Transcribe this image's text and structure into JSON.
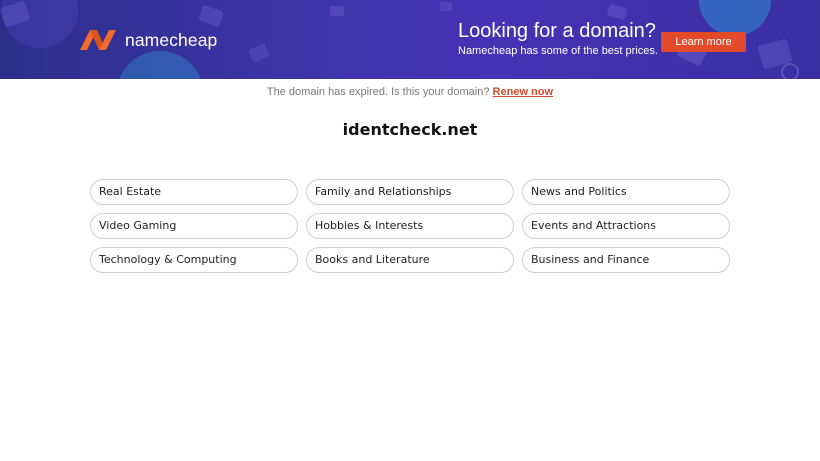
{
  "banner": {
    "brand_name": "namecheap",
    "logo_icon": "namecheap-n-logo-icon",
    "promo_title": "Looking for a domain?",
    "promo_subtitle": "Namecheap has some of the best prices.",
    "learn_more_label": "Learn more",
    "colors": {
      "background": "#3d34a8",
      "accent": "#e34a2a",
      "logo_orange": "#f26a2c"
    }
  },
  "notice": {
    "text": "The domain has expired. Is this your domain?",
    "link_label": "Renew now",
    "link_color": "#d14a2b"
  },
  "domain_name": "identcheck.net",
  "topics": [
    "Real Estate",
    "Family and Relationships",
    "News and Politics",
    "Video Gaming",
    "Hobbies & Interests",
    "Events and Attractions",
    "Technology & Computing",
    "Books and Literature",
    "Business and Finance"
  ]
}
